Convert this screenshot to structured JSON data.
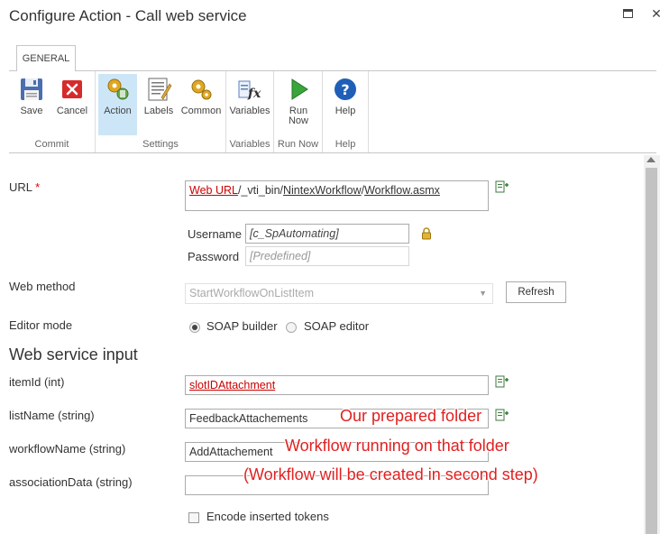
{
  "window": {
    "title": "Configure Action - Call web service",
    "maximize_icon": "maximize-icon",
    "close_glyph": "✕"
  },
  "ribbon": {
    "tab_label": "GENERAL",
    "groups": {
      "commit": "Commit",
      "settings": "Settings",
      "variables": "Variables",
      "run_now": "Run Now",
      "help": "Help"
    },
    "buttons": {
      "save": "Save",
      "cancel": "Cancel",
      "action": "Action",
      "labels": "Labels",
      "common": "Common",
      "variables": "Variables",
      "run_line1": "Run",
      "run_line2": "Now",
      "help": "Help"
    }
  },
  "form": {
    "url_label": "URL",
    "required_marker": "*",
    "url_value_part1": "Web URL",
    "url_value_part2": "/_vti_bin/",
    "url_value_part3": "NintexWorkflow",
    "url_value_part4": "/",
    "url_value_part5": "Workflow.asmx",
    "username_label": "Username",
    "username_value": "[c_SpAutomating]",
    "password_label": "Password",
    "password_value": "[Predefined]",
    "web_method_label": "Web method",
    "web_method_value": "StartWorkflowOnListItem",
    "refresh_button": "Refresh",
    "editor_mode_label": "Editor mode",
    "soap_builder": "SOAP builder",
    "soap_editor": "SOAP editor",
    "section_title": "Web service input",
    "item_id_label": "itemId (int)",
    "item_id_value": "slotIDAttachment",
    "list_name_label": "listName (string)",
    "list_name_value": "FeedbackAttachements",
    "workflow_name_label": "workflowName (string)",
    "workflow_name_value": "AddAttachement",
    "association_label": "associationData (string)",
    "association_value": "",
    "encode_label": "Encode inserted tokens"
  },
  "annotations": {
    "note1": "Our prepared folder",
    "note2": "Workflow running on that folder",
    "note3": "(Workflow will be created in second step)"
  },
  "colors": {
    "annotation": "#e02020",
    "selected_button": "#cde6f7",
    "token_red": "#c00000"
  }
}
